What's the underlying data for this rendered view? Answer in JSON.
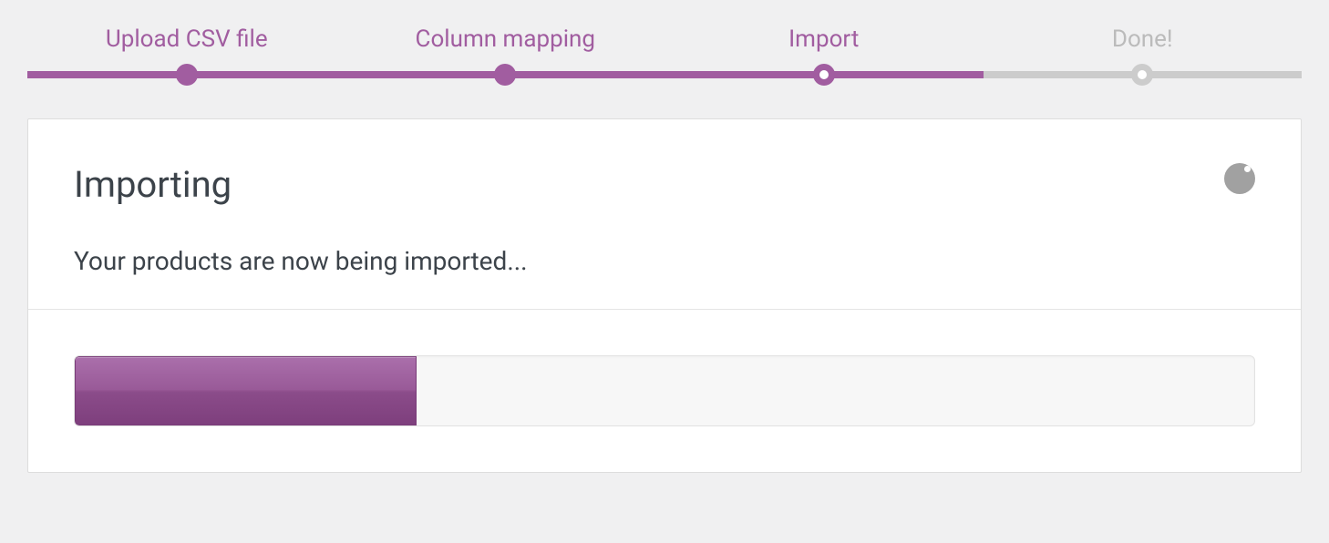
{
  "colors": {
    "accent": "#a15da0",
    "pending": "#ccc",
    "text": "#3c434a"
  },
  "stepper": {
    "steps": [
      {
        "label": "Upload CSV file",
        "state": "done"
      },
      {
        "label": "Column mapping",
        "state": "done"
      },
      {
        "label": "Import",
        "state": "current"
      },
      {
        "label": "Done!",
        "state": "pending"
      }
    ],
    "progress_percent": 75
  },
  "card": {
    "title": "Importing",
    "subtitle": "Your products are now being imported..."
  },
  "progress": {
    "percent": 29
  }
}
